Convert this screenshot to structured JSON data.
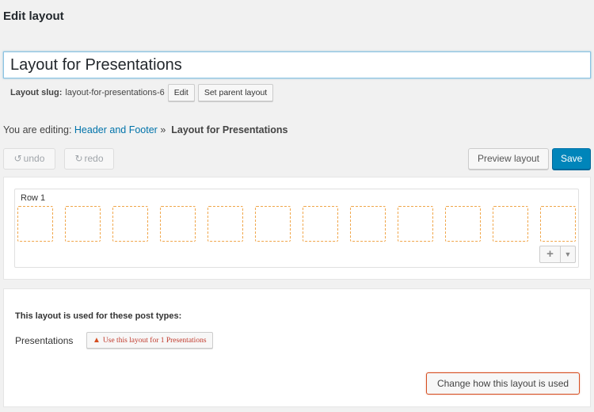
{
  "page": {
    "title": "Edit layout"
  },
  "layout": {
    "name": "Layout for Presentations",
    "slug_label": "Layout slug:",
    "slug_value": "layout-for-presentations-6",
    "edit_label": "Edit",
    "set_parent_label": "Set parent layout"
  },
  "breadcrumb": {
    "prefix": "You are editing:",
    "parent": "Header and Footer",
    "separator": "»",
    "current": "Layout for Presentations"
  },
  "toolbar": {
    "undo_icon": "undo-icon",
    "undo_label": "undo",
    "redo_icon": "redo-icon",
    "redo_label": "redo",
    "preview_label": "Preview layout",
    "save_label": "Save",
    "save_color": "#0085ba"
  },
  "grid": {
    "row_label": "Row 1",
    "cell_count": 12,
    "cell_border_color": "#f0a64a",
    "add_icon": "plus-icon",
    "menu_icon": "caret-down-icon"
  },
  "usage": {
    "heading": "This layout is used for these post types:",
    "post_type": "Presentations",
    "warning_icon": "warning-icon",
    "use_button_label": "Use this layout for 1 Presentations",
    "change_button_label": "Change how this layout is used",
    "accent_color": "#d54e21"
  }
}
